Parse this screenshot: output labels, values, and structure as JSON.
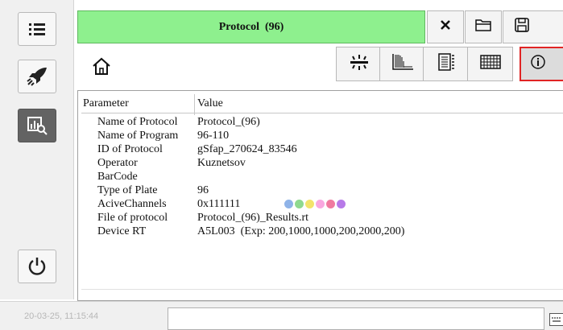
{
  "window": {
    "title": "Protocol  (96)",
    "title_bg": "#8ef08e",
    "active_border": "#e02424"
  },
  "sidebar": {
    "items": [
      {
        "icon": "list-icon"
      },
      {
        "icon": "rocket-icon"
      },
      {
        "icon": "chart-search-icon"
      },
      {
        "icon": "power-icon"
      }
    ]
  },
  "title_buttons": [
    {
      "icon": "close-icon"
    },
    {
      "icon": "folder-icon"
    },
    {
      "icon": "save-icon"
    }
  ],
  "toolbar": {
    "home_icon": "home-icon",
    "views": [
      {
        "icon": "sun-bar-icon"
      },
      {
        "icon": "plot-icon"
      },
      {
        "icon": "list-box-icon"
      },
      {
        "icon": "grid-icon"
      },
      {
        "icon": "info-icon",
        "active": true
      }
    ]
  },
  "info": {
    "header_param": "Parameter",
    "header_value": "Value",
    "rows": [
      {
        "key": "Name of Protocol",
        "value": "Protocol_(96)"
      },
      {
        "key": "Name of Program",
        "value": "96-110"
      },
      {
        "key": "ID of Protocol",
        "value": "gSfap_270624_83546"
      },
      {
        "key": "Operator",
        "value": "Kuznetsov"
      },
      {
        "key": "BarCode",
        "value": ""
      },
      {
        "key": "Type of Plate",
        "value": "96"
      },
      {
        "key": "AciveChannels",
        "value": "0x111111"
      },
      {
        "key": "File of protocol",
        "value": "Protocol_(96)_Results.rt"
      },
      {
        "key": "Device RT",
        "value": "A5L003  (Exp: 200,1000,1000,200,2000,200)"
      }
    ],
    "channel_colors": [
      "#8fb3e8",
      "#8fd98f",
      "#f3e36b",
      "#f9a8e0",
      "#f07aa0",
      "#b77ae8"
    ]
  },
  "statusbar": {
    "time": "20-03-25, 11:15:44"
  }
}
